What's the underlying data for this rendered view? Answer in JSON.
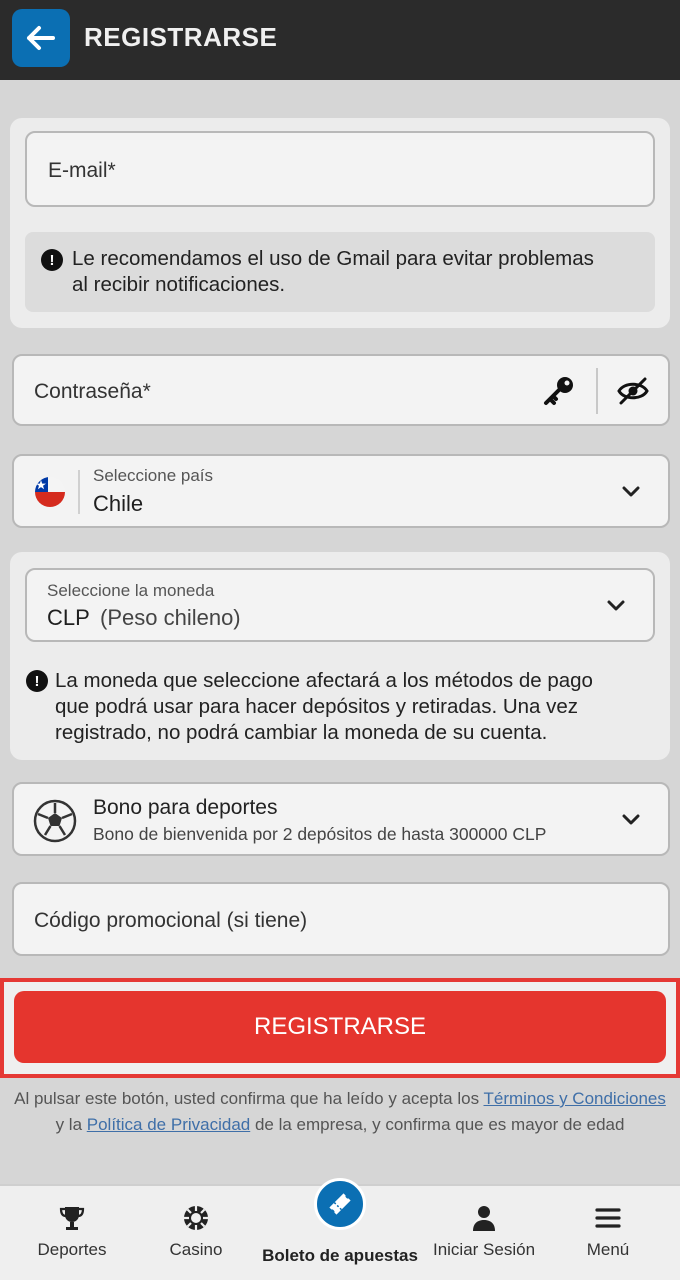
{
  "header": {
    "title": "REGISTRARSE",
    "back_icon": "arrow-left-icon"
  },
  "form": {
    "email": {
      "placeholder": "E-mail*"
    },
    "email_notice": {
      "line1": "Le recomendamos el uso de Gmail para evitar problemas",
      "line2": "al recibir notificaciones."
    },
    "password": {
      "placeholder": "Contraseña*"
    },
    "country": {
      "label": "Seleccione país",
      "value": "Chile"
    },
    "currency": {
      "label": "Seleccione la moneda",
      "code": "CLP",
      "name": "(Peso chileno)",
      "notice_line1": "La moneda que seleccione afectará a los métodos de pago",
      "notice_line2": "que podrá usar para hacer depósitos y retiradas. Una vez",
      "notice_line3": "registrado, no podrá cambiar la moneda de su cuenta."
    },
    "bonus": {
      "title": "Bono para deportes",
      "subtitle": "Bono de bienvenida por 2 depósitos de hasta 300000 CLP"
    },
    "promo": {
      "placeholder": "Código promocional (si tiene)"
    },
    "submit_label": "REGISTRARSE",
    "disclaimer": {
      "part1": "Al pulsar este botón, usted confirma que ha leído y acepta los ",
      "terms_link": "Términos y Condiciones",
      "part2": " y la ",
      "privacy_link": "Política de Privacidad",
      "part3": " de la empresa, y confirma que es mayor de edad"
    }
  },
  "bottom_nav": {
    "items": [
      {
        "label": "Deportes",
        "icon": "trophy-icon"
      },
      {
        "label": "Casino",
        "icon": "casino-chip-icon"
      },
      {
        "label": "Boleto de apuestas",
        "icon": "ticket-icon"
      },
      {
        "label": "Iniciar Sesión",
        "icon": "user-icon"
      },
      {
        "label": "Menú",
        "icon": "menu-icon"
      }
    ]
  },
  "colors": {
    "header_bg": "#2b2b2b",
    "back_button": "#0b6fb3",
    "primary_red": "#e5352e",
    "link_blue": "#3f6fa8"
  }
}
